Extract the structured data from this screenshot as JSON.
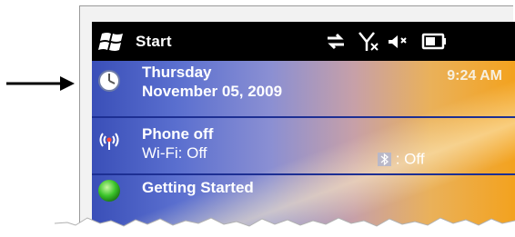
{
  "title_bar": {
    "start_label": "Start",
    "icons": [
      "windows-flag-icon",
      "data-sync-icon",
      "signal-off-icon",
      "speaker-muted-icon",
      "battery-icon"
    ]
  },
  "today": {
    "date_row": {
      "day": "Thursday",
      "date": "November 05, 2009",
      "time": "9:24 AM",
      "icon": "clock-icon"
    },
    "phone_row": {
      "status": "Phone off",
      "wifi": "Wi-Fi: Off",
      "bluetooth": ": Off",
      "icon": "wireless-icon",
      "bluetooth_icon": "bluetooth-icon"
    },
    "getting_started_row": {
      "label": "Getting Started",
      "icon": "getting-started-icon"
    }
  },
  "colors": {
    "title_bar": "#000000",
    "divider": "#1d2f93",
    "gradient_left": "#3a4fb8",
    "gradient_right": "#f3a21e"
  }
}
